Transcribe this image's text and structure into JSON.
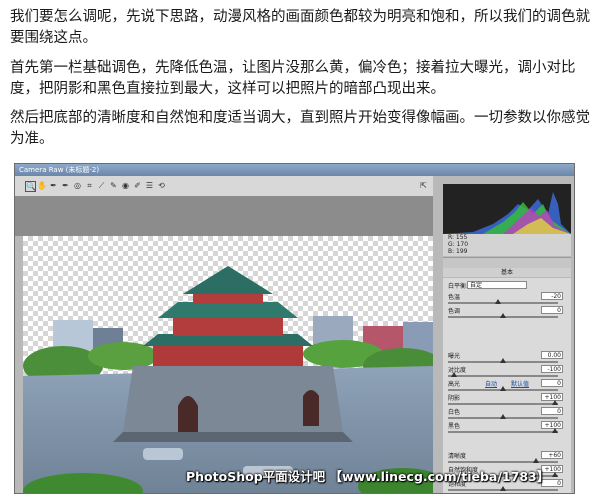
{
  "article": {
    "p1": "我们要怎么调呢，先说下思路，动漫风格的画面颜色都较为明亮和饱和，所以我们的调色就要围绕这点。",
    "p2": "首先第一栏基础调色，先降低色温，让图片没那么黄，偏冷色；接着拉大曝光，调小对比度，把阴影和黑色直接拉到最大，这样可以把照片的暗部凸现出来。",
    "p3": "然后把底部的清晰度和自然饱和度适当调大，直到照片开始变得像幅画。一切参数以你感觉为准。"
  },
  "camera_raw": {
    "title": "Camera Raw (未标题-2)",
    "info": {
      "r": "R: 155",
      "g": "G: 170",
      "b": "B: 199"
    },
    "panel_title": "基本",
    "white_balance": {
      "label": "白平衡:",
      "value": "自定"
    },
    "links": {
      "auto": "自动",
      "default": "默认值"
    },
    "sliders": [
      {
        "label": "色温",
        "value": "-20",
        "pos": 0.45
      },
      {
        "label": "色调",
        "value": "0",
        "pos": 0.5
      },
      {
        "label": "曝光",
        "value": "0.00",
        "pos": 0.5
      },
      {
        "label": "对比度",
        "value": "-100",
        "pos": 0.05
      },
      {
        "label": "高光",
        "value": "0",
        "pos": 0.5
      },
      {
        "label": "阴影",
        "value": "+100",
        "pos": 0.97
      },
      {
        "label": "白色",
        "value": "0",
        "pos": 0.5
      },
      {
        "label": "黑色",
        "value": "+100",
        "pos": 0.97
      },
      {
        "label": "清晰度",
        "value": "+60",
        "pos": 0.8
      },
      {
        "label": "自然饱和度",
        "value": "+100",
        "pos": 0.97
      },
      {
        "label": "饱和度",
        "value": "0",
        "pos": 0.5
      }
    ]
  },
  "watermark": "PhotoShop平面设计吧 【www.linecg.com/tieba/1783】",
  "colors": {
    "sky_blue": "#9cc4e8",
    "roof_green": "#2c6e63",
    "wall_gray": "#7a8694"
  }
}
